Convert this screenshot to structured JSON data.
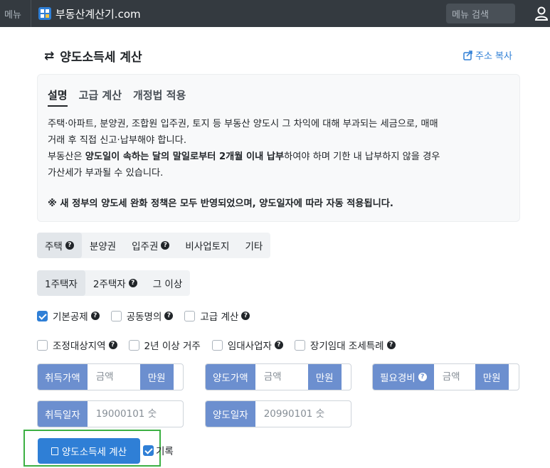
{
  "navbar": {
    "menu": "메뉴",
    "brand": "부동산계산기.com",
    "search_placeholder": "메뉴 검색"
  },
  "header": {
    "title": "양도소득세 계산",
    "copy_link": "주소 복사"
  },
  "info": {
    "tabs": [
      "설명",
      "고급 계산",
      "개정법 적용"
    ],
    "line1": "주택·아파트, 분양권, 조합원 입주권, 토지 등 부동산 양도시 그 차익에 대해 부과되는 세금으로, 매매",
    "line2": "거래 후 직접 신고·납부해야 합니다.",
    "line3_pre": "부동산은 ",
    "line3_bold": "양도일이 속하는 달의 말일로부터 2개월 이내 납부",
    "line3_post": "하여야 하며 기한 내 납부하지 않을 경우",
    "line4": "가산세가 부과될 수 있습니다.",
    "notice": "※ 새 정부의 양도세 완화 정책은 모두 반영되었으며, 양도일자에 따라 자동 적용됩니다."
  },
  "property_types": [
    {
      "label": "주택",
      "help": true,
      "active": true
    },
    {
      "label": "분양권",
      "help": false,
      "active": false
    },
    {
      "label": "입주권",
      "help": true,
      "active": false
    },
    {
      "label": "비사업토지",
      "help": false,
      "active": false
    },
    {
      "label": "기타",
      "help": false,
      "active": false
    }
  ],
  "house_counts": [
    {
      "label": "1주택자",
      "help": false,
      "active": true
    },
    {
      "label": "2주택자",
      "help": true,
      "active": false
    },
    {
      "label": "그 이상",
      "help": false,
      "active": false
    }
  ],
  "options_row1": [
    {
      "label": "기본공제",
      "checked": true
    },
    {
      "label": "공동명의",
      "checked": false
    },
    {
      "label": "고급 계산",
      "checked": false
    }
  ],
  "options_row2": [
    {
      "label": "조정대상지역",
      "checked": false
    },
    {
      "label": "2년 이상 거주",
      "checked": false
    },
    {
      "label": "임대사업자",
      "checked": false
    },
    {
      "label": "장기임대 조세특례",
      "checked": false
    }
  ],
  "inputs": {
    "acquisition_price": {
      "label": "취득가액",
      "placeholder": "금액",
      "unit": "만원"
    },
    "transfer_price": {
      "label": "양도가액",
      "placeholder": "금액",
      "unit": "만원"
    },
    "expenses": {
      "label": "필요경비",
      "placeholder": "금액",
      "unit": "만원"
    },
    "acquisition_date": {
      "label": "취득일자",
      "placeholder": "19000101 숫"
    },
    "transfer_date": {
      "label": "양도일자",
      "placeholder": "20990101 숫"
    }
  },
  "actions": {
    "calculate": "양도소득세 계산",
    "record": "기록",
    "record_checked": true
  },
  "colors": {
    "navbar": "#343a40",
    "primary": "#2f7fd6",
    "label_bg": "#6c8fcf",
    "highlight_frame": "#3cb043"
  }
}
